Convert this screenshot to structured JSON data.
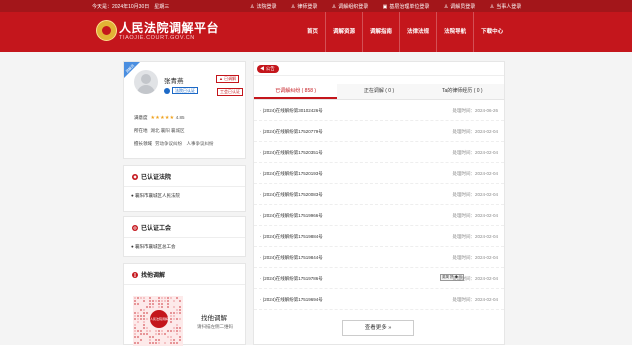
{
  "topbar": {
    "date": "今天是：2024年10月30日　星期三",
    "links": [
      {
        "icon": "user-icon",
        "label": "法院登录"
      },
      {
        "icon": "user-icon",
        "label": "律师登录"
      },
      {
        "icon": "user-icon",
        "label": "调解组织登录"
      },
      {
        "icon": "building-icon",
        "label": "基层治理单位登录"
      },
      {
        "icon": "user-icon",
        "label": "调解员登录"
      },
      {
        "icon": "user-icon",
        "label": "当事人登录"
      }
    ]
  },
  "brand": {
    "title": "人民法院调解平台",
    "subtitle": "TIAOJIE.COURT.GOV.CN"
  },
  "nav": [
    "首页",
    "调解资源",
    "调解指南",
    "法律法规",
    "法院导航",
    "下载中心"
  ],
  "profile": {
    "corner_label": "调解员",
    "name": "张青燕",
    "apply_label": "已调解",
    "court_badge": "法院已认证",
    "union_badge": "工会已认证",
    "satisfaction_label": "满意度",
    "stars": "★★★★★",
    "rating": "4.85",
    "location_label": "所在地",
    "location": "湖北 襄阳 襄城区",
    "field_label": "擅长领域",
    "field": "劳动争议纠纷　人事争议纠纷"
  },
  "court_section": {
    "title": "已认证法院",
    "item": "襄阳市襄城区人民法院"
  },
  "union_section": {
    "title": "已认证工会",
    "item": "襄阳市襄城区总工会"
  },
  "mediate_section": {
    "title": "找他调解",
    "seal_text": "人民法院调解",
    "qr_title": "找他调解",
    "qr_sub": "请扫描左侧二维码"
  },
  "notice": {
    "tag": "公告",
    "tabs": [
      "已调解纠纷 ( 858 )",
      "正在调解 ( 0 )",
      "Ta的律师经历 ( 0 )"
    ],
    "date_label": "处理时间：",
    "items": [
      {
        "title": "· (2024)在线解纷第30102426号",
        "date": "2024-06-26"
      },
      {
        "title": "· (2024)在线解纷第17520779号",
        "date": "2024-02-04"
      },
      {
        "title": "· (2024)在线解纷第17520351号",
        "date": "2024-02-04"
      },
      {
        "title": "· (2024)在线解纷第17520193号",
        "date": "2024-02-04"
      },
      {
        "title": "· (2024)在线解纷第17520083号",
        "date": "2024-02-04"
      },
      {
        "title": "· (2024)在线解纷第17519966号",
        "date": "2024-02-04"
      },
      {
        "title": "· (2024)在线解纷第17519884号",
        "date": "2024-02-04"
      },
      {
        "title": "· (2024)在线解纷第17519844号",
        "date": "2024-02-04"
      },
      {
        "title": "· (2024)在线解纷第17519786号",
        "date": "2024-02-04"
      },
      {
        "title": "· (2024)在线解纷第17519694号",
        "date": "2024-02-04"
      }
    ],
    "ime_badge": "英简 拼 ◆ 与",
    "more": "查看更多 »"
  },
  "colors": {
    "brand_red": "#c4161c",
    "top_red": "#a3161a",
    "accent_blue": "#1d6ac7",
    "star_gold": "#f0a21e"
  }
}
